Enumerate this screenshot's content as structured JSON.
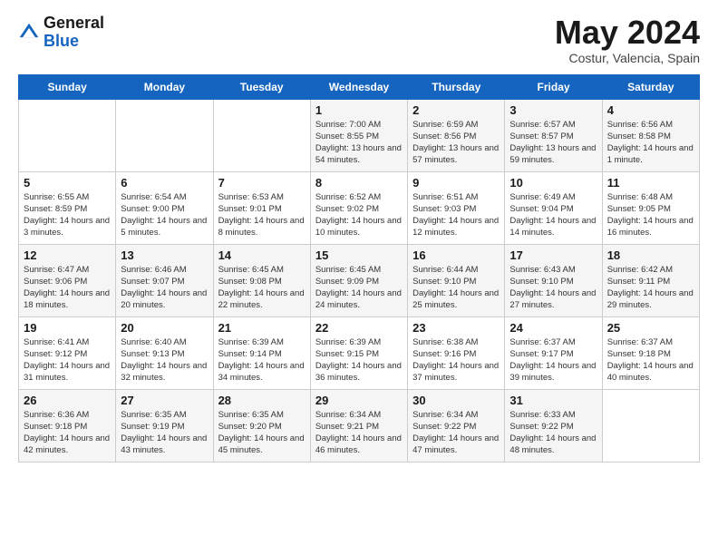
{
  "header": {
    "logo_general": "General",
    "logo_blue": "Blue",
    "month_title": "May 2024",
    "location": "Costur, Valencia, Spain"
  },
  "days_of_week": [
    "Sunday",
    "Monday",
    "Tuesday",
    "Wednesday",
    "Thursday",
    "Friday",
    "Saturday"
  ],
  "weeks": [
    [
      {
        "day": "",
        "info": ""
      },
      {
        "day": "",
        "info": ""
      },
      {
        "day": "",
        "info": ""
      },
      {
        "day": "1",
        "info": "Sunrise: 7:00 AM\nSunset: 8:55 PM\nDaylight: 13 hours\nand 54 minutes."
      },
      {
        "day": "2",
        "info": "Sunrise: 6:59 AM\nSunset: 8:56 PM\nDaylight: 13 hours\nand 57 minutes."
      },
      {
        "day": "3",
        "info": "Sunrise: 6:57 AM\nSunset: 8:57 PM\nDaylight: 13 hours\nand 59 minutes."
      },
      {
        "day": "4",
        "info": "Sunrise: 6:56 AM\nSunset: 8:58 PM\nDaylight: 14 hours\nand 1 minute."
      }
    ],
    [
      {
        "day": "5",
        "info": "Sunrise: 6:55 AM\nSunset: 8:59 PM\nDaylight: 14 hours\nand 3 minutes."
      },
      {
        "day": "6",
        "info": "Sunrise: 6:54 AM\nSunset: 9:00 PM\nDaylight: 14 hours\nand 5 minutes."
      },
      {
        "day": "7",
        "info": "Sunrise: 6:53 AM\nSunset: 9:01 PM\nDaylight: 14 hours\nand 8 minutes."
      },
      {
        "day": "8",
        "info": "Sunrise: 6:52 AM\nSunset: 9:02 PM\nDaylight: 14 hours\nand 10 minutes."
      },
      {
        "day": "9",
        "info": "Sunrise: 6:51 AM\nSunset: 9:03 PM\nDaylight: 14 hours\nand 12 minutes."
      },
      {
        "day": "10",
        "info": "Sunrise: 6:49 AM\nSunset: 9:04 PM\nDaylight: 14 hours\nand 14 minutes."
      },
      {
        "day": "11",
        "info": "Sunrise: 6:48 AM\nSunset: 9:05 PM\nDaylight: 14 hours\nand 16 minutes."
      }
    ],
    [
      {
        "day": "12",
        "info": "Sunrise: 6:47 AM\nSunset: 9:06 PM\nDaylight: 14 hours\nand 18 minutes."
      },
      {
        "day": "13",
        "info": "Sunrise: 6:46 AM\nSunset: 9:07 PM\nDaylight: 14 hours\nand 20 minutes."
      },
      {
        "day": "14",
        "info": "Sunrise: 6:45 AM\nSunset: 9:08 PM\nDaylight: 14 hours\nand 22 minutes."
      },
      {
        "day": "15",
        "info": "Sunrise: 6:45 AM\nSunset: 9:09 PM\nDaylight: 14 hours\nand 24 minutes."
      },
      {
        "day": "16",
        "info": "Sunrise: 6:44 AM\nSunset: 9:10 PM\nDaylight: 14 hours\nand 25 minutes."
      },
      {
        "day": "17",
        "info": "Sunrise: 6:43 AM\nSunset: 9:10 PM\nDaylight: 14 hours\nand 27 minutes."
      },
      {
        "day": "18",
        "info": "Sunrise: 6:42 AM\nSunset: 9:11 PM\nDaylight: 14 hours\nand 29 minutes."
      }
    ],
    [
      {
        "day": "19",
        "info": "Sunrise: 6:41 AM\nSunset: 9:12 PM\nDaylight: 14 hours\nand 31 minutes."
      },
      {
        "day": "20",
        "info": "Sunrise: 6:40 AM\nSunset: 9:13 PM\nDaylight: 14 hours\nand 32 minutes."
      },
      {
        "day": "21",
        "info": "Sunrise: 6:39 AM\nSunset: 9:14 PM\nDaylight: 14 hours\nand 34 minutes."
      },
      {
        "day": "22",
        "info": "Sunrise: 6:39 AM\nSunset: 9:15 PM\nDaylight: 14 hours\nand 36 minutes."
      },
      {
        "day": "23",
        "info": "Sunrise: 6:38 AM\nSunset: 9:16 PM\nDaylight: 14 hours\nand 37 minutes."
      },
      {
        "day": "24",
        "info": "Sunrise: 6:37 AM\nSunset: 9:17 PM\nDaylight: 14 hours\nand 39 minutes."
      },
      {
        "day": "25",
        "info": "Sunrise: 6:37 AM\nSunset: 9:18 PM\nDaylight: 14 hours\nand 40 minutes."
      }
    ],
    [
      {
        "day": "26",
        "info": "Sunrise: 6:36 AM\nSunset: 9:18 PM\nDaylight: 14 hours\nand 42 minutes."
      },
      {
        "day": "27",
        "info": "Sunrise: 6:35 AM\nSunset: 9:19 PM\nDaylight: 14 hours\nand 43 minutes."
      },
      {
        "day": "28",
        "info": "Sunrise: 6:35 AM\nSunset: 9:20 PM\nDaylight: 14 hours\nand 45 minutes."
      },
      {
        "day": "29",
        "info": "Sunrise: 6:34 AM\nSunset: 9:21 PM\nDaylight: 14 hours\nand 46 minutes."
      },
      {
        "day": "30",
        "info": "Sunrise: 6:34 AM\nSunset: 9:22 PM\nDaylight: 14 hours\nand 47 minutes."
      },
      {
        "day": "31",
        "info": "Sunrise: 6:33 AM\nSunset: 9:22 PM\nDaylight: 14 hours\nand 48 minutes."
      },
      {
        "day": "",
        "info": ""
      }
    ]
  ]
}
